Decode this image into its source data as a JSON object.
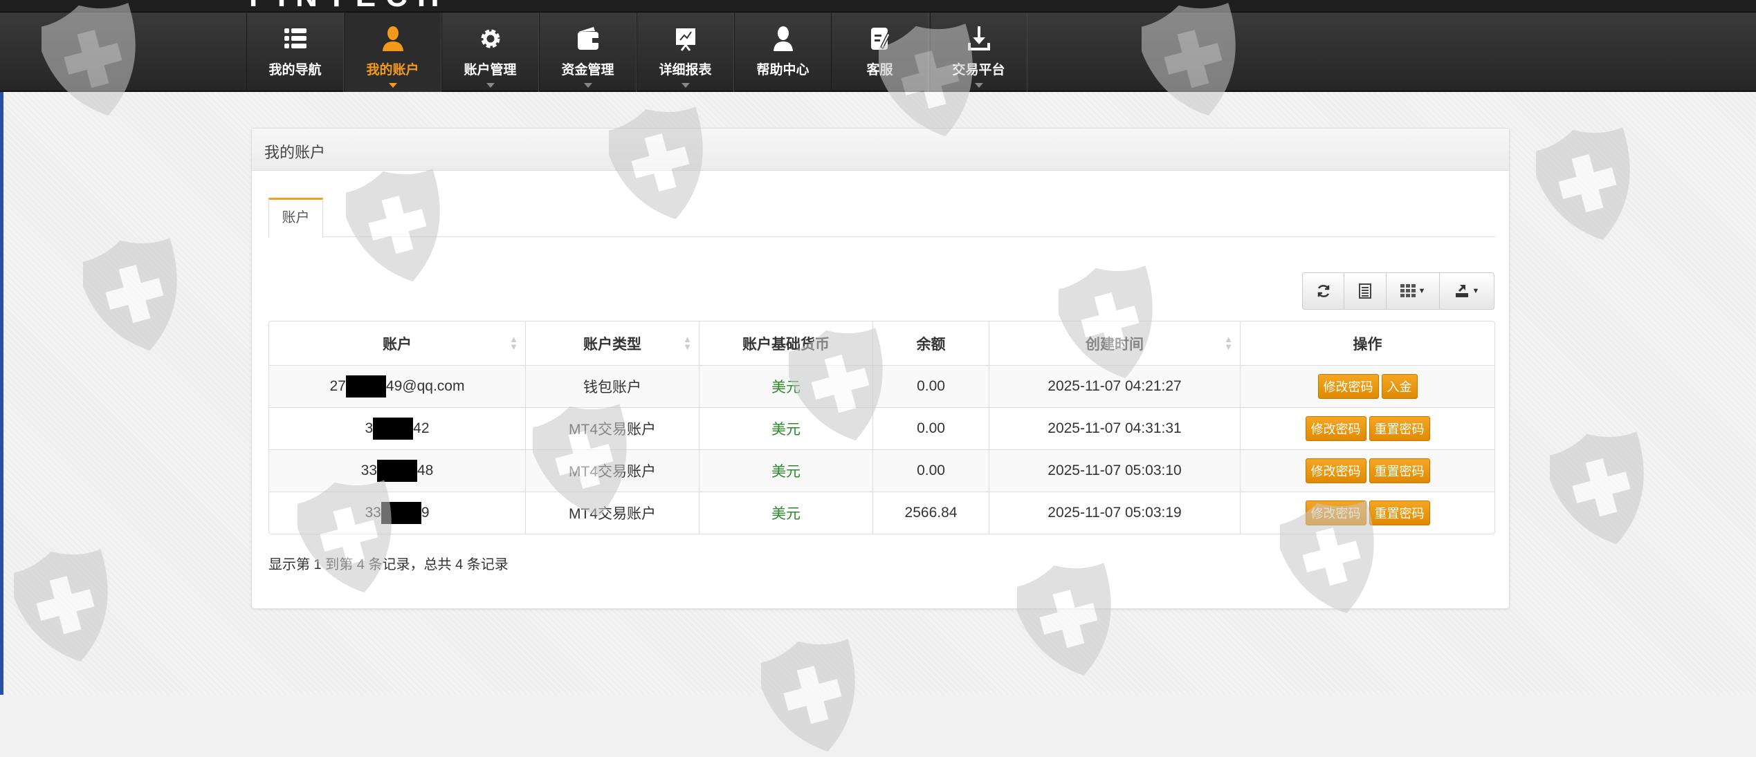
{
  "logo": {
    "text": "FINTECH"
  },
  "nav": [
    {
      "label": "我的导航",
      "icon": "list-icon",
      "active": false
    },
    {
      "label": "我的账户",
      "icon": "user-icon",
      "active": true
    },
    {
      "label": "账户管理",
      "icon": "gear-icon",
      "active": false
    },
    {
      "label": "资金管理",
      "icon": "wallet-icon",
      "active": false
    },
    {
      "label": "详细报表",
      "icon": "chart-board-icon",
      "active": false
    },
    {
      "label": "帮助中心",
      "icon": "person-icon",
      "active": false
    },
    {
      "label": "客服",
      "icon": "edit-note-icon",
      "active": false
    },
    {
      "label": "交易平台",
      "icon": "download-icon",
      "active": false
    }
  ],
  "panel": {
    "title": "我的账户",
    "tab": "账户"
  },
  "table": {
    "headers": [
      "账户",
      "账户类型",
      "账户基础货币",
      "余额",
      "创建时间",
      "操作"
    ],
    "rows": [
      {
        "acct_pre": "27",
        "acct_suf": "49@qq.com",
        "type": "钱包账户",
        "currency": "美元",
        "balance": "0.00",
        "created": "2025-11-07 04:21:27",
        "actions": [
          "修改密码",
          "入金"
        ]
      },
      {
        "acct_pre": "3",
        "acct_suf": "42",
        "type": "MT4交易账户",
        "currency": "美元",
        "balance": "0.00",
        "created": "2025-11-07 04:31:31",
        "actions": [
          "修改密码",
          "重置密码"
        ]
      },
      {
        "acct_pre": "33",
        "acct_suf": "48",
        "type": "MT4交易账户",
        "currency": "美元",
        "balance": "0.00",
        "created": "2025-11-07 05:03:10",
        "actions": [
          "修改密码",
          "重置密码"
        ]
      },
      {
        "acct_pre": "33",
        "acct_suf": "9",
        "type": "MT4交易账户",
        "currency": "美元",
        "balance": "2566.84",
        "created": "2025-11-07 05:03:19",
        "actions": [
          "修改密码",
          "重置密码"
        ]
      }
    ]
  },
  "footer": "显示第 1 到第 4 条记录，总共 4 条记录",
  "colors": {
    "accent": "#f39a1d",
    "currency": "#2a8a2a"
  }
}
